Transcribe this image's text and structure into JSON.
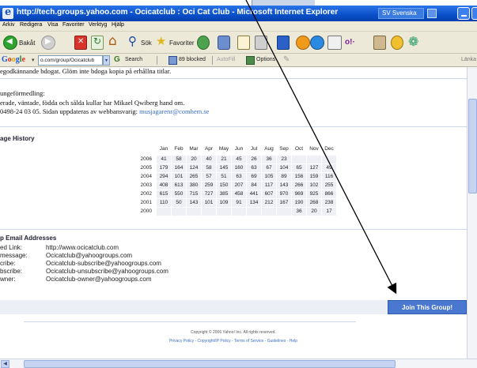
{
  "window": {
    "title": "http://tech.groups.yahoo.com - Ocicatclub : Oci Cat Club - Microsoft Internet Explorer",
    "language": "SV Svenska"
  },
  "menu": [
    "Arkiv",
    "Redigera",
    "Visa",
    "Favoriter",
    "Verktyg",
    "Hjälp"
  ],
  "toolbar": {
    "back_label": "Bakåt",
    "search_label": "Sök",
    "favorites_label": "Favoriter"
  },
  "googlebar": {
    "address": "o.com/group/Ocicatclub",
    "search_label": "Search",
    "blocked_label": "89 blocked",
    "autofill_label": "AutoFill",
    "options_label": "Options",
    "links_label": "Länka"
  },
  "page": {
    "top_text": "egodkännande bdogat. Glöm inte bdoga kopia på erhållna titlar.",
    "mediation_title": "ungeförmedling:",
    "mediation_line1": "erade, väntade, födda och sålda kullar har Mikael Qwiberg hand om.",
    "mediation_line2_prefix": "0498-24 03 05. Sidan uppdateras av webbansvarig: ",
    "mediation_email": "musjagarenr@comhem.se",
    "history_title": "age History",
    "history": {
      "months": [
        "Jan",
        "Feb",
        "Mar",
        "Apr",
        "May",
        "Jun",
        "Jul",
        "Aug",
        "Sep",
        "Oct",
        "Nov",
        "Dec"
      ],
      "rows": [
        {
          "year": "2006",
          "values": [
            "41",
            "58",
            "20",
            "40",
            "21",
            "45",
            "26",
            "36",
            "23",
            "",
            "",
            ""
          ]
        },
        {
          "year": "2005",
          "values": [
            "179",
            "164",
            "124",
            "58",
            "145",
            "160",
            "63",
            "67",
            "104",
            "65",
            "127",
            "49"
          ]
        },
        {
          "year": "2004",
          "values": [
            "294",
            "101",
            "265",
            "57",
            "51",
            "63",
            "69",
            "105",
            "89",
            "156",
            "159",
            "116"
          ]
        },
        {
          "year": "2003",
          "values": [
            "408",
            "613",
            "380",
            "259",
            "150",
            "207",
            "84",
            "117",
            "143",
            "266",
            "102",
            "255"
          ]
        },
        {
          "year": "2002",
          "values": [
            "615",
            "550",
            "715",
            "727",
            "385",
            "458",
            "441",
            "607",
            "970",
            "969",
            "925",
            "866"
          ]
        },
        {
          "year": "2001",
          "values": [
            "110",
            "50",
            "143",
            "101",
            "109",
            "91",
            "134",
            "212",
            "167",
            "190",
            "268",
            "238"
          ]
        },
        {
          "year": "2000",
          "values": [
            "",
            "",
            "",
            "",
            "",
            "",
            "",
            "",
            "",
            "36",
            "20",
            "17"
          ]
        }
      ]
    },
    "email_title": "p Email Addresses",
    "emails": [
      {
        "label": "ed Link:",
        "value": "http://www.ocicatclub.com",
        "link": true
      },
      {
        "label": "message:",
        "value": "Ocicatclub@yahoogroups.com",
        "link": false
      },
      {
        "label": "cribe:",
        "value": "Ocicatclub-subscribe@yahoogroups.com",
        "link": false
      },
      {
        "label": "bscribe:",
        "value": "Ocicatclub-unsubscribe@yahoogroups.com",
        "link": false
      },
      {
        "label": "wner:",
        "value": "Ocicatclub-owner@yahoogroups.com",
        "link": false
      }
    ],
    "join_button": "Join This Group!",
    "footer_copyright": "Copyright © 2006 Yahoo! Inc. All rights reserved.",
    "footer_links": "Privacy Policy - Copyright/IP Policy - Terms of Service - Guidelines - Help"
  }
}
